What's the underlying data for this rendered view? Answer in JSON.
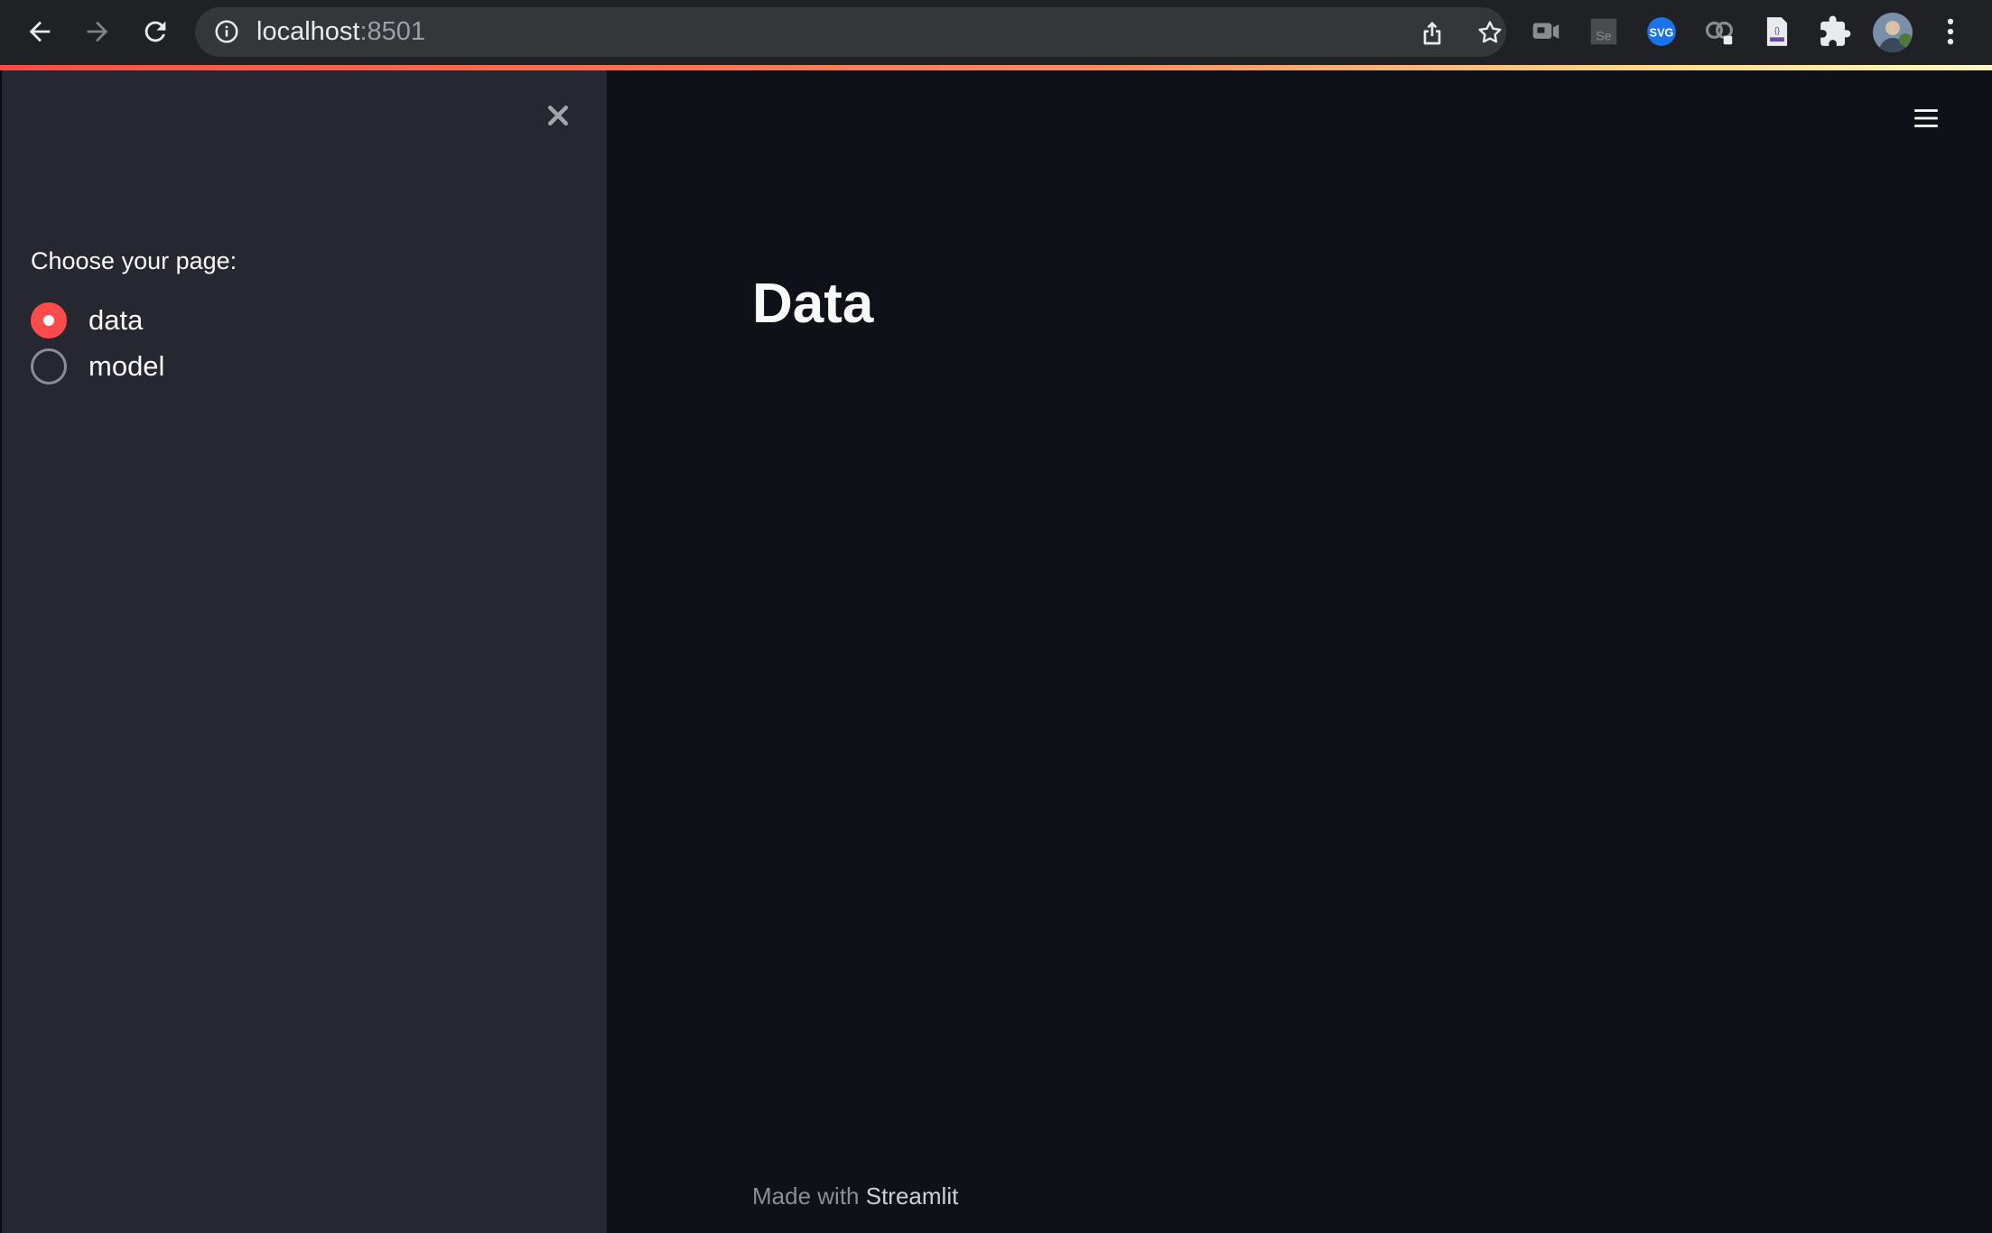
{
  "browser": {
    "url_host": "localhost",
    "url_port": ":8501"
  },
  "sidebar": {
    "radio_label": "Choose your page:",
    "options": [
      {
        "label": "data",
        "selected": true
      },
      {
        "label": "model",
        "selected": false
      }
    ]
  },
  "main": {
    "title": "Data"
  },
  "footer": {
    "prefix": "Made with",
    "brand": "Streamlit"
  },
  "colors": {
    "accent": "#ff4b4b",
    "sidebar_bg": "#262730",
    "main_bg": "#0e1117",
    "chrome_bg": "#202124"
  },
  "extension_icons": [
    "video-capture-extension-icon",
    "selenium-extension-icon",
    "svg-extension-icon",
    "owl-extension-icon",
    "json-extension-icon"
  ]
}
